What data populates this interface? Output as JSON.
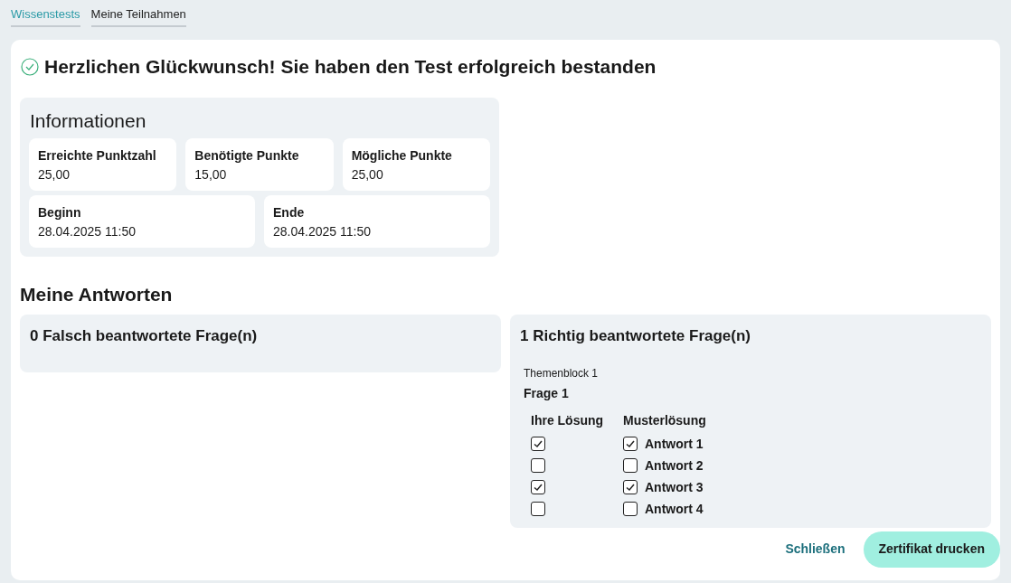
{
  "tabs": [
    {
      "label": "Wissenstests",
      "selected": true
    },
    {
      "label": "Meine Teilnahmen",
      "selected": false
    }
  ],
  "title": "Herzlichen Glückwunsch! Sie haben den Test erfolgreich bestanden",
  "info": {
    "heading": "Informationen",
    "rows": [
      [
        {
          "label": "Erreichte Punktzahl",
          "value": "25,00"
        },
        {
          "label": "Benötigte Punkte",
          "value": "15,00"
        },
        {
          "label": "Mögliche Punkte",
          "value": "25,00"
        }
      ],
      [
        {
          "label": "Beginn",
          "value": "28.04.2025 11:50"
        },
        {
          "label": "Ende",
          "value": "28.04.2025 11:50"
        }
      ]
    ]
  },
  "answers": {
    "heading": "Meine Antworten",
    "wrong": {
      "heading": "0 Falsch beantwortete Frage(n)"
    },
    "right": {
      "heading": "1 Richtig beantwortete Frage(n)",
      "questions": [
        {
          "block": "Themenblock 1",
          "title": "Frage 1",
          "your_header": "Ihre Lösung",
          "model_header": "Musterlösung",
          "options": [
            {
              "label": "Antwort 1",
              "yours": true,
              "model": true
            },
            {
              "label": "Antwort 2",
              "yours": false,
              "model": false
            },
            {
              "label": "Antwort 3",
              "yours": true,
              "model": true
            },
            {
              "label": "Antwort 4",
              "yours": false,
              "model": false
            }
          ]
        }
      ]
    }
  },
  "buttons": {
    "close": "Schließen",
    "print": "Zertifikat drucken"
  }
}
